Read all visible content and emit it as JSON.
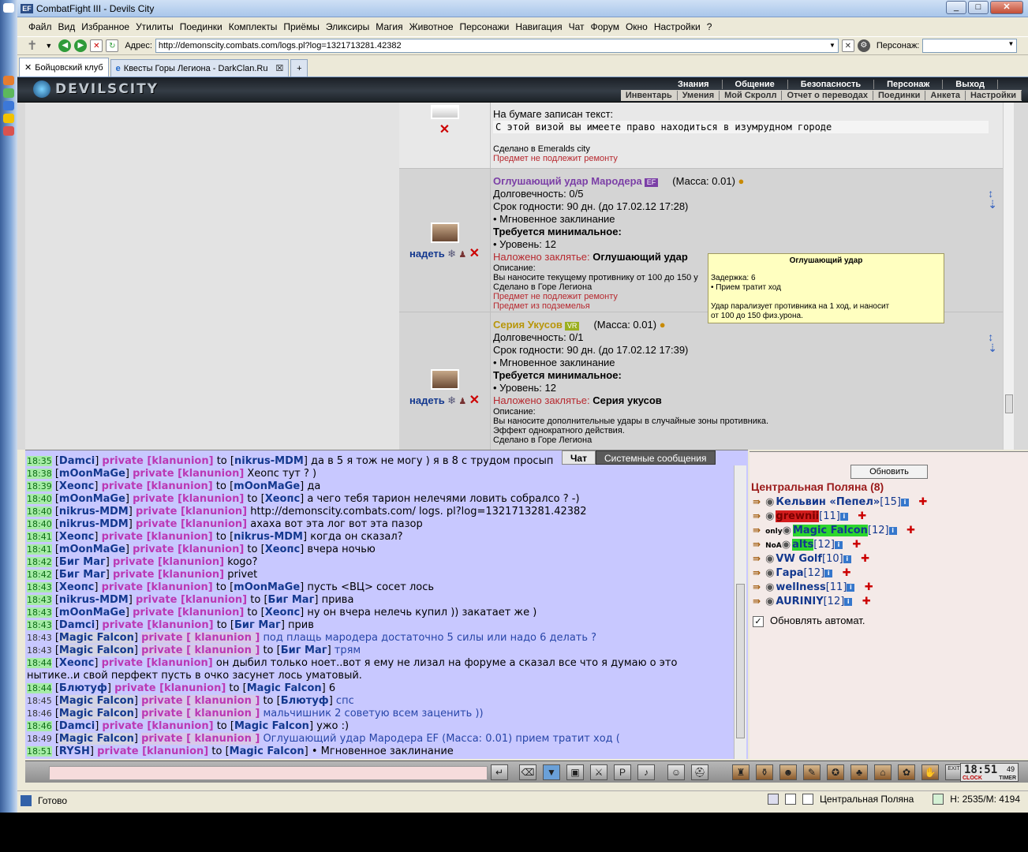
{
  "window": {
    "title": "CombatFight III - Devils City",
    "minimize": "_",
    "maximize": "□",
    "close": "✕"
  },
  "menu": [
    "Файл",
    "Вид",
    "Избранное",
    "Утилиты",
    "Поединки",
    "Комплекты",
    "Приёмы",
    "Эликсиры",
    "Магия",
    "Животное",
    "Персонажи",
    "Навигация",
    "Чат",
    "Форум",
    "Окно",
    "Настройки",
    "?"
  ],
  "address": {
    "label": "Адрес:",
    "url": "http://demonscity.combats.com/logs.pl?log=1321713281.42382",
    "pers_label": "Персонаж:"
  },
  "tabs": [
    {
      "label": "Бойцовский клуб",
      "active": true
    },
    {
      "label": "Квесты Горы Легиона - DarkClan.Ru",
      "active": false
    }
  ],
  "game_header": {
    "logo": "DEVILSCITY",
    "top_links": [
      "Знания",
      "Общение",
      "Безопасность",
      "Персонаж",
      "Выход"
    ],
    "sub_links": [
      "Инвентарь",
      "Умения",
      "Мой Скролл",
      "Отчет о переводах",
      "Поединки",
      "Анкета",
      "Настройки"
    ]
  },
  "items": [
    {
      "note_label": "На бумаге записан текст:",
      "note_text": "С этой визой вы имеете право находиться в изумрудном городе",
      "made": "Сделано в Emeralds city",
      "flag": "Предмет не подлежит ремонту"
    },
    {
      "name": "Оглушающий удар Мародера",
      "tag": "EF",
      "mass": "(Масса: 0.01)",
      "durability": "Долговечность: 0/5",
      "expiry": "Срок годности: 90 дн. (до 17.02.12 17:28)",
      "bullet": "• Мгновенное заклинание",
      "req_label": "Требуется минимальное:",
      "level": "• Уровень: 12",
      "spell_label": "Наложено заклятье:",
      "spell": "Оглушающий удар",
      "desc_label": "Описание:",
      "desc": "Вы наносите текущему противнику от 100 до 150 у",
      "made": "Сделано в Горе Легиона",
      "flags": [
        "Предмет не подлежит ремонту",
        "Предмет из подземелья"
      ],
      "wear": "надеть"
    },
    {
      "name": "Серия Укусов",
      "tag": "VR",
      "mass": "(Масса: 0.01)",
      "durability": "Долговечность: 0/1",
      "expiry": "Срок годности: 90 дн. (до 17.02.12 17:39)",
      "bullet": "• Мгновенное заклинание",
      "req_label": "Требуется минимальное:",
      "level": "• Уровень: 12",
      "spell_label": "Наложено заклятье:",
      "spell": "Серия укусов",
      "desc_label": "Описание:",
      "desc1": "Вы наносите дополнительные удары в случайные зоны противника.",
      "desc2": "Эффект однократного действия.",
      "made": "Сделано в Горе Легиона",
      "wear": "надеть"
    }
  ],
  "tooltip": {
    "title": "Оглушающий удар",
    "delay": "Задержка: 6",
    "move": "• Прием тратит ход",
    "desc1": "Удар парализует противника на 1 ход, и наносит",
    "desc2": "от 100 до 150 физ.урона."
  },
  "chat_tabs": [
    "Чат",
    "Системные сообщения"
  ],
  "chat": [
    {
      "t": "18:35",
      "from": "Damci",
      "priv": "private [klanunion]",
      "to": "nikrus-MDM",
      "msg": "да в 5 я тож не могу ) я в 8 с трудом просып",
      "style": "a"
    },
    {
      "t": "18:38",
      "from": "mOonMaGe",
      "priv": "private [klanunion]",
      "to": "",
      "msg": "Хеопс тут ? )",
      "style": "b"
    },
    {
      "t": "18:39",
      "from": "Хеопс",
      "priv": "private [klanunion]",
      "to": "mOonMaGe",
      "msg": "да",
      "style": "a"
    },
    {
      "t": "18:40",
      "from": "mOonMaGe",
      "priv": "private [klanunion]",
      "to": "Хеопс",
      "msg": "а чего тебя тарион нелечями ловить собралсо ? -)",
      "style": "a"
    },
    {
      "t": "18:40",
      "from": "nikrus-MDM",
      "priv": "private [klanunion]",
      "to": "",
      "msg": "http://demonscity.combats.com/ logs. pl?log=1321713281.42382",
      "style": "a"
    },
    {
      "t": "18:40",
      "from": "nikrus-MDM",
      "priv": "private [klanunion]",
      "to": "",
      "msg": "ахаха вот эта лог вот эта пазор",
      "style": "a"
    },
    {
      "t": "18:41",
      "from": "Хеопс",
      "priv": "private [klanunion]",
      "to": "nikrus-MDM",
      "msg": "когда он сказал?",
      "style": "a"
    },
    {
      "t": "18:41",
      "from": "mOonMaGe",
      "priv": "private [klanunion]",
      "to": "Хеопс",
      "msg": "вчера ночью",
      "style": "a"
    },
    {
      "t": "18:42",
      "from": "Биг Маг",
      "priv": "private [klanunion]",
      "to": "",
      "msg": "kogo?",
      "style": "a"
    },
    {
      "t": "18:42",
      "from": "Биг Маг",
      "priv": "private [klanunion]",
      "to": "",
      "msg": "privet",
      "style": "a"
    },
    {
      "t": "18:43",
      "from": "Хеопс",
      "priv": "private [klanunion]",
      "to": "mOonMaGe",
      "msg": "пусть <ВЦ> сосет лось",
      "style": "a"
    },
    {
      "t": "18:43",
      "from": "nikrus-MDM",
      "priv": "private [klanunion]",
      "to": "Биг Маг",
      "msg": "прива",
      "style": "a"
    },
    {
      "t": "18:43",
      "from": "mOonMaGe",
      "priv": "private [klanunion]",
      "to": "Хеопс",
      "msg": "ну он вчера нелечь купил )) закатает же )",
      "style": "a"
    },
    {
      "t": "18:43",
      "from": "Damci",
      "priv": "private [klanunion]",
      "to": "Биг Маг",
      "msg": "прив",
      "style": "a"
    },
    {
      "t": "18:43",
      "from": "Magic Falcon",
      "priv": "private [ klanunion ]",
      "to": "",
      "msg": "под плащь мародера достаточно 5 силы или надо 6 делать ?",
      "style": "c"
    },
    {
      "t": "18:43",
      "from": "Magic Falcon",
      "priv": "private [ klanunion ]",
      "to": "Биг Маг",
      "msg": "трям",
      "style": "c"
    },
    {
      "t": "18:44",
      "from": "Хеопс",
      "priv": "private [klanunion]",
      "to": "",
      "msg": "он дыбил только ноет..вот я ему не лизал на форуме а сказал все что я думаю о это",
      "style": "a"
    },
    {
      "t": "",
      "from": "",
      "priv": "",
      "to": "",
      "msg": "нытике..и свой перфект пусть в очко засунет лось уматовый.",
      "style": "cont"
    },
    {
      "t": "18:44",
      "from": "Блютуф",
      "priv": "private [klanunion]",
      "to": "Magic Falcon",
      "msg": "6",
      "style": "a"
    },
    {
      "t": "18:45",
      "from": "Magic Falcon",
      "priv": "private [ klanunion ]",
      "to": "Блютуф",
      "msg": "спс",
      "style": "c"
    },
    {
      "t": "18:46",
      "from": "Magic Falcon",
      "priv": "private [ klanunion ]",
      "to": "",
      "msg": "мальчишник 2 советую всем заценить ))",
      "style": "c"
    },
    {
      "t": "18:46",
      "from": "Damci",
      "priv": "private [klanunion]",
      "to": "Magic Falcon",
      "msg": "ужо :)",
      "style": "a"
    },
    {
      "t": "18:49",
      "from": "Magic Falcon",
      "priv": "private [ klanunion ]",
      "to": "",
      "msg": "Оглушающий удар Мародера EF (Масса: 0.01) прием тратит ход (",
      "style": "c"
    },
    {
      "t": "18:51",
      "from": "RYSH",
      "priv": "private [klanunion]",
      "to": "Magic Falcon",
      "msg": "• Мгновенное заклинание",
      "style": "a"
    }
  ],
  "chat_to_word": "to",
  "online": {
    "refresh": "Обновить",
    "location": "Центральная Поляна (8)",
    "players": [
      {
        "name": "Кельвин «Пепел»",
        "level": "[15]",
        "badge": "",
        "hl": ""
      },
      {
        "name": "grewnii",
        "level": "[11]",
        "badge": "",
        "hl": "red"
      },
      {
        "name": "Magic Falcon",
        "level": "[12]",
        "badge": "only",
        "hl": "green"
      },
      {
        "name": "alts",
        "level": "[12]",
        "badge": "NoA",
        "hl": "green"
      },
      {
        "name": "VW Golf",
        "level": "[10]",
        "badge": "",
        "hl": ""
      },
      {
        "name": "Гара",
        "level": "[12]",
        "badge": "",
        "hl": ""
      },
      {
        "name": "wellness",
        "level": "[11]",
        "badge": "",
        "hl": ""
      },
      {
        "name": "AURINIY",
        "level": "[12]",
        "badge": "",
        "hl": ""
      }
    ],
    "auto_refresh": "Обновлять автомат."
  },
  "clock": {
    "time": "18:51",
    "sec": "49",
    "label1": "CLOCK",
    "label2": "TIMER",
    "exit": "EXIT"
  },
  "status": {
    "ready": "Готово",
    "location": "Центральная Поляна",
    "hp": "H: 2535/M: 4194"
  }
}
